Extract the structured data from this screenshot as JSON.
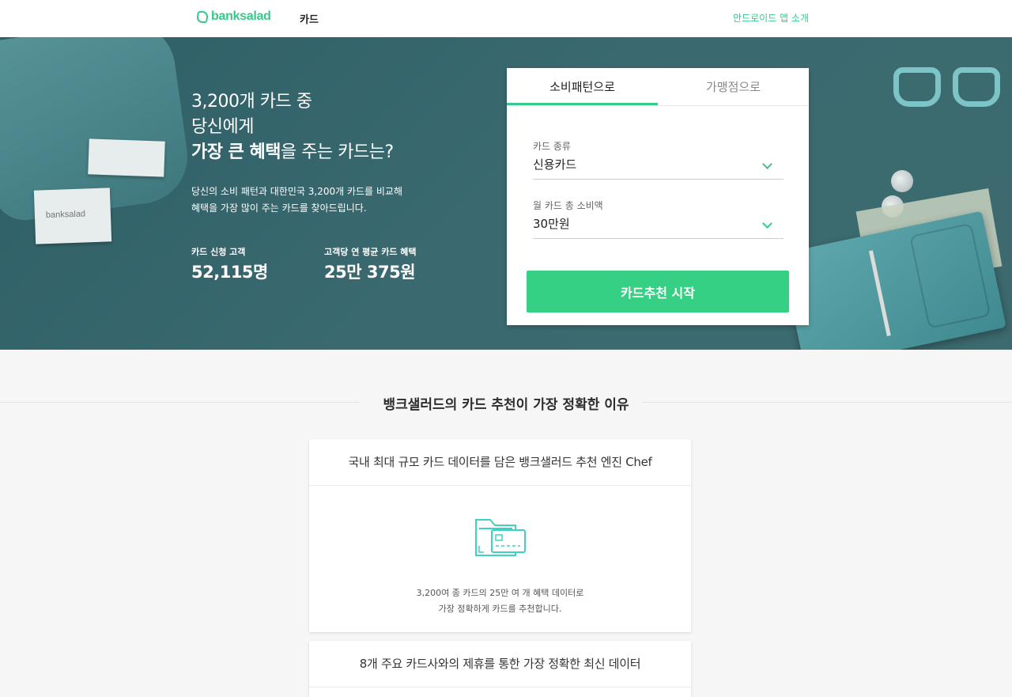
{
  "header": {
    "logo_text": "banksalad",
    "nav_card": "카드",
    "nav_android": "안드로이드 앱 소개"
  },
  "hero": {
    "title_line1": "3,200개 카드 중",
    "title_line2": "당신에게",
    "title_bold": "가장 큰 혜택",
    "title_tail": "을 주는 카드는?",
    "desc_line1": "당신의 소비 패턴과 대한민국 3,200개 카드를 비교해",
    "desc_line2": "혜택을 가장 많이 주는 카드를 찾아드립니다.",
    "stats": [
      {
        "label": "카드 신청 고객",
        "value": "52,115명"
      },
      {
        "label": "고객당 연 평균 카드 혜택",
        "value": "25만 375원"
      }
    ],
    "deco_paper_text": "banksalad"
  },
  "form": {
    "tabs": [
      {
        "label": "소비패턴으로",
        "active": true
      },
      {
        "label": "가맹점으로",
        "active": false
      }
    ],
    "card_type": {
      "label": "카드 종류",
      "value": "신용카드"
    },
    "monthly_spend": {
      "label": "월 카드 총 소비액",
      "value": "30만원"
    },
    "start_button": "카드추천 시작"
  },
  "section": {
    "title": "뱅크샐러드의 카드 추천이 가장 정확한 이유",
    "reasons": [
      {
        "title": "국내 최대 규모 카드 데이터를 담은 뱅크샐러드 추천 엔진 Chef",
        "icon": "folder-card-icon",
        "desc_line1": "3,200여 종 카드의 25만 여 개 혜택 데이터로",
        "desc_line2": "가장 정확하게 카드를 추천합니다."
      },
      {
        "title": "8개 주요 카드사와의 제휴를 통한 가장 정확한 최신 데이터"
      }
    ]
  },
  "colors": {
    "brand_green": "#35c98a",
    "button_green": "#35d083",
    "hero_bg": "#2f5f66"
  }
}
